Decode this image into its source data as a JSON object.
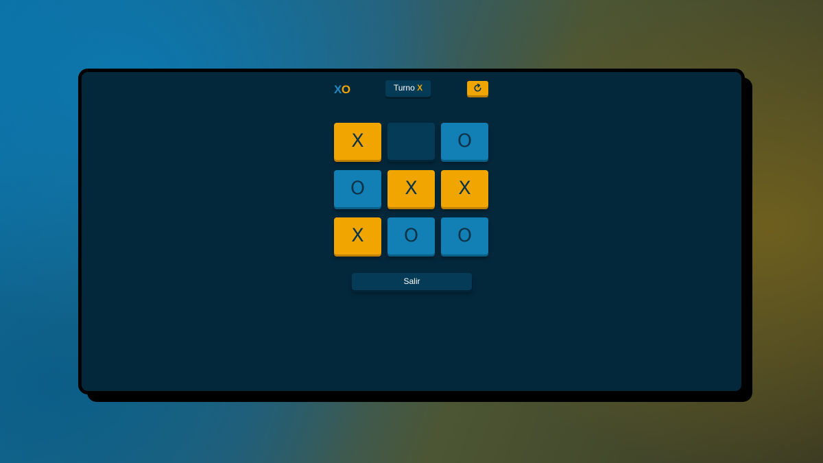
{
  "logo": {
    "x": "X",
    "o": "O"
  },
  "turn": {
    "label": "Turno",
    "mark": "X"
  },
  "controls": {
    "restart_icon": "restart-icon",
    "exit_label": "Salir"
  },
  "colors": {
    "x": "#f0a500",
    "o": "#1280b5",
    "board_bg": "#03283c"
  },
  "board": {
    "cells": [
      "X",
      "",
      "O",
      "O",
      "X",
      "X",
      "X",
      "O",
      "O"
    ]
  }
}
